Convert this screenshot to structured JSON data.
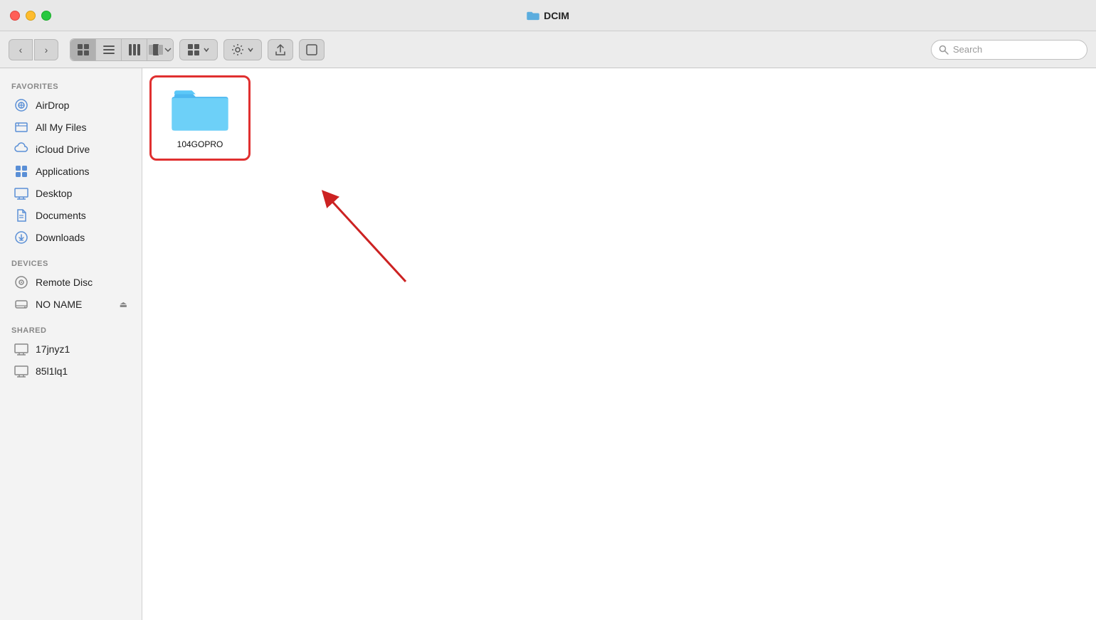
{
  "titleBar": {
    "title": "DCIM",
    "trafficLights": {
      "close": "close",
      "minimize": "minimize",
      "maximize": "maximize"
    }
  },
  "toolbar": {
    "backLabel": "‹",
    "forwardLabel": "›",
    "views": [
      {
        "id": "icon",
        "label": "⊞",
        "active": true
      },
      {
        "id": "list",
        "label": "≡",
        "active": false
      },
      {
        "id": "column",
        "label": "⊟",
        "active": false
      },
      {
        "id": "cover",
        "label": "⊠",
        "active": false
      }
    ],
    "arrange": "⊞ ▾",
    "gear": "⚙ ▾",
    "share": "⬆",
    "tag": "⬜",
    "searchPlaceholder": "Search"
  },
  "sidebar": {
    "favoritesLabel": "Favorites",
    "items": [
      {
        "id": "airdrop",
        "icon": "airdrop",
        "label": "AirDrop"
      },
      {
        "id": "all-my-files",
        "icon": "files",
        "label": "All My Files"
      },
      {
        "id": "icloud",
        "icon": "cloud",
        "label": "iCloud Drive"
      },
      {
        "id": "applications",
        "icon": "apps",
        "label": "Applications"
      },
      {
        "id": "desktop",
        "icon": "desktop",
        "label": "Desktop"
      },
      {
        "id": "documents",
        "icon": "document",
        "label": "Documents"
      },
      {
        "id": "downloads",
        "icon": "download",
        "label": "Downloads"
      }
    ],
    "devicesLabel": "Devices",
    "deviceItems": [
      {
        "id": "remote-disc",
        "icon": "disc",
        "label": "Remote Disc",
        "eject": false
      },
      {
        "id": "no-name",
        "icon": "drive",
        "label": "NO NAME",
        "eject": true
      }
    ],
    "sharedLabel": "Shared",
    "sharedItems": [
      {
        "id": "17jnyz1",
        "icon": "monitor",
        "label": "17jnyz1"
      },
      {
        "id": "85l1lq1",
        "icon": "monitor",
        "label": "85l1lq1"
      }
    ]
  },
  "fileArea": {
    "folders": [
      {
        "id": "104gopro",
        "name": "104GOPRO",
        "selected": true
      }
    ]
  }
}
